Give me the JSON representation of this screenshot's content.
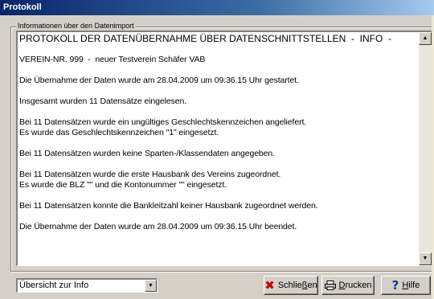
{
  "window": {
    "title": "Protokoll"
  },
  "group": {
    "legend": "Informationen über den Datenimport"
  },
  "memo": {
    "lines": [
      "PROTOKOLL DER DATENÜBERNAHME ÜBER DATENSCHNITTSTELLEN  -  INFO  -",
      "",
      "VEREIN-NR. 999  -  neuer Testverein Schäfer VAB",
      "",
      "Die Übernahme der Daten wurde am 28.04.2009 um 09:36.15 Uhr gestartet.",
      "",
      "Insgesamt wurden 11 Datensätze eingelesen.",
      "",
      "Bei 11 Datensätzen wurde ein ungültiges Geschlechtskennzeichen angeliefert.",
      "Es wurde das Geschlechtskennzeichen \"1\" eingesetzt.",
      "",
      "Bei 11 Datensätzen wurden keine Sparten-/Klassendaten angegeben.",
      "",
      "Bei 11 Datensätzen wurde die erste Hausbank des Vereins zugeordnet.",
      "Es wurde die BLZ \"\" und die Kontonummer \"\" eingesetzt.",
      "",
      "Bei 11 Datensätzen konnte die Bankleitzahl keiner Hausbank zugeordnet werden.",
      "",
      "Die Übernahme der Daten wurde am 28.04.2009 um 09:36.15 Uhr beendet."
    ]
  },
  "combo": {
    "value": "Übersicht zur Info"
  },
  "buttons": {
    "close": {
      "label_pre": "Schlie",
      "label_ul": "ß",
      "label_post": "en",
      "icon": "red-x-icon"
    },
    "print": {
      "label_ul": "D",
      "label_post": "rucken",
      "icon": "printer-icon"
    },
    "help": {
      "label_ul": "H",
      "label_post": "ilfe",
      "icon": "question-icon"
    }
  }
}
